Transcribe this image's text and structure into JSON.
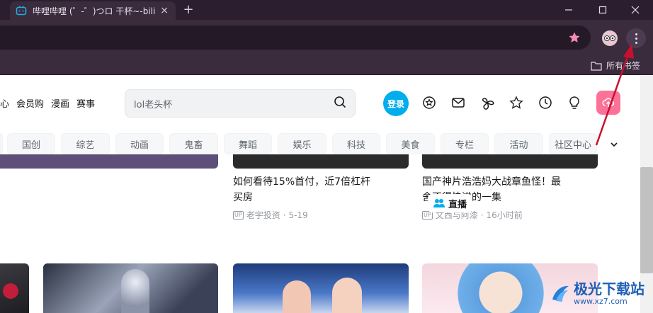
{
  "browser": {
    "tab_title": "哔哩哔哩 (゜-゜)つロ 干杯~-bili",
    "tab_close": "×",
    "new_tab": "+",
    "bookmark_folder": "所有书签"
  },
  "header": {
    "nav_links": [
      "心",
      "会员购",
      "漫画",
      "赛事"
    ],
    "search_placeholder": "lol老头杯",
    "login": "登录"
  },
  "channels": [
    "国创",
    "综艺",
    "动画",
    "鬼畜",
    "舞蹈",
    "娱乐",
    "科技",
    "美食",
    "专栏",
    "活动",
    "社区中心"
  ],
  "cards": [
    {
      "title_line1": "如何看待15%首付，近7倍杠杆",
      "title_line2": "买房",
      "up_badge": "UP",
      "author": "老宇投资",
      "date": "5-19"
    },
    {
      "title_line1": "国产神片浩浩妈大战章鱼怪！最",
      "title_line2": "舍不得快进的一集",
      "up_badge": "UP",
      "author": "文西与阿漆",
      "date": "16小时前"
    }
  ],
  "live_badge": "直播",
  "watermark": {
    "name": "极光下载站",
    "url": "www.xz7.com"
  },
  "colors": {
    "accent": "#00aeec",
    "pink": "#fb7299",
    "arrow": "#c8102e"
  }
}
